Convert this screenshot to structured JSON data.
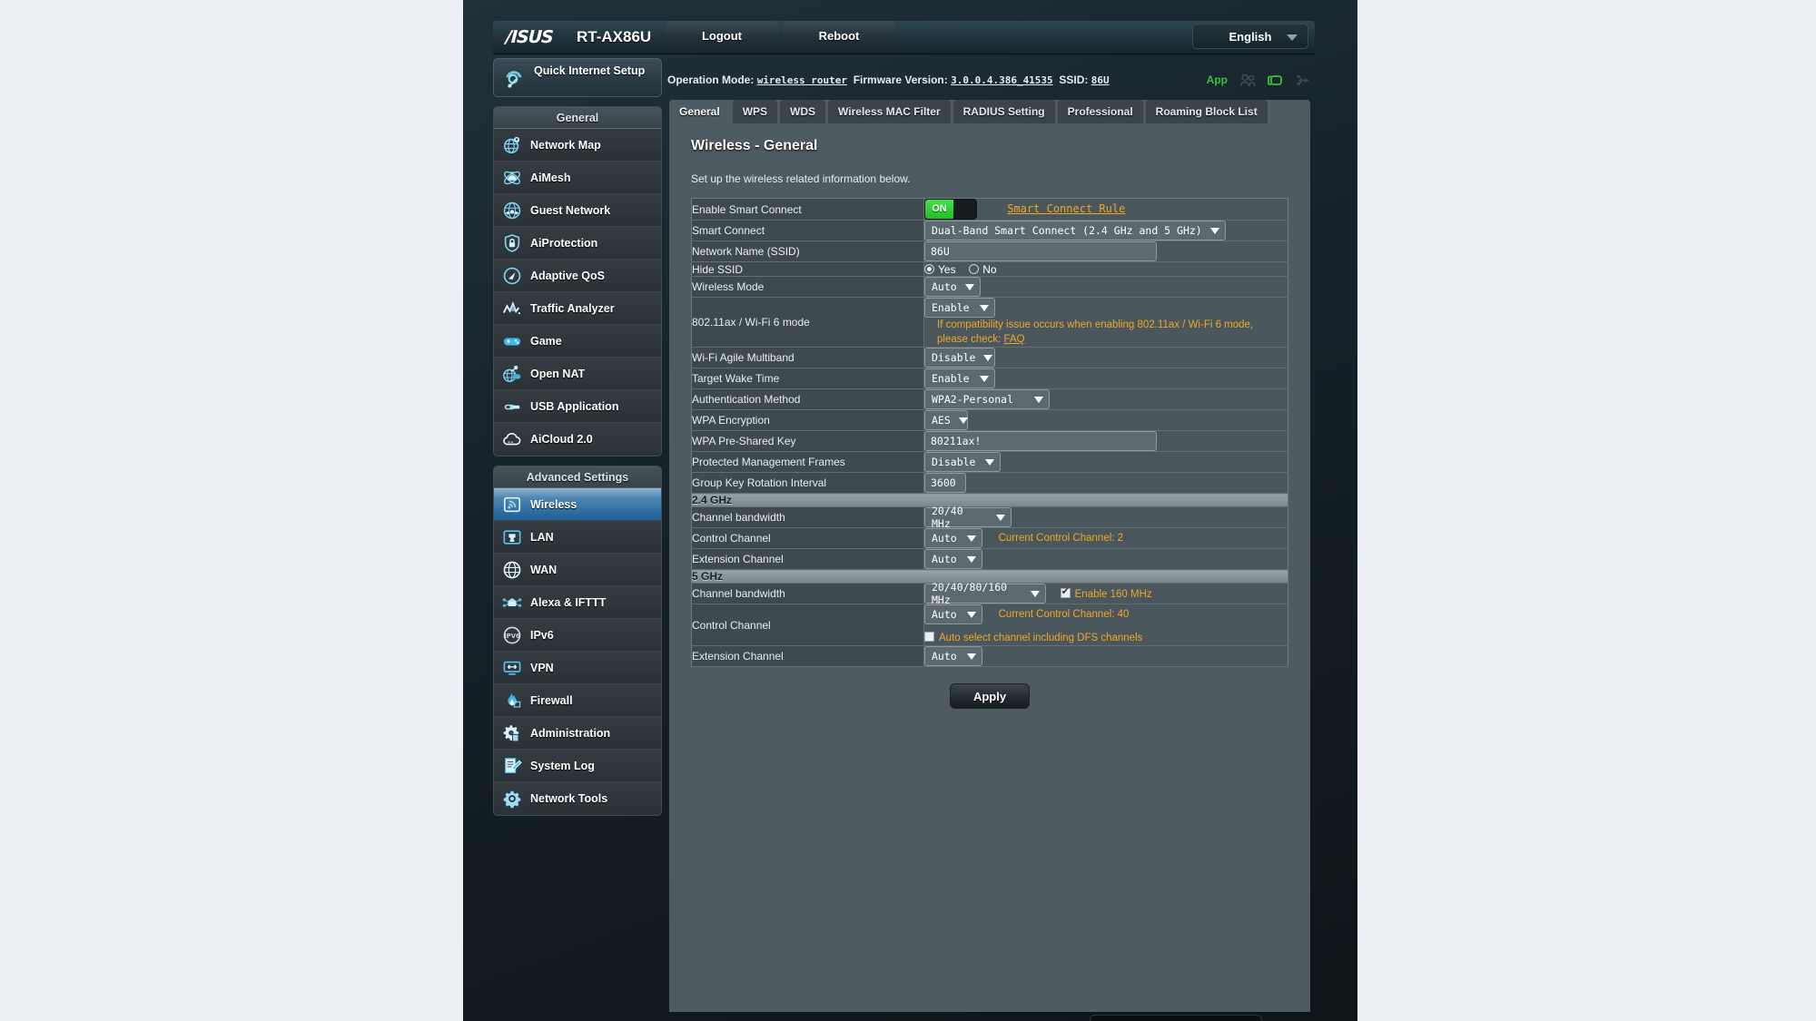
{
  "header": {
    "brand": "/ISUS",
    "model": "RT-AX86U",
    "logout_label": "Logout",
    "reboot_label": "Reboot",
    "language": "English"
  },
  "infobar": {
    "operation_mode_label": "Operation Mode:",
    "operation_mode_value": "wireless router",
    "firmware_label": "Firmware Version:",
    "firmware_value": "3.0.0.4.386_41535",
    "ssid_label": "SSID:",
    "ssid_value": "86U",
    "app_label": "App"
  },
  "sidebar": {
    "quick_setup": "Quick Internet Setup",
    "general_header": "General",
    "general_items": [
      {
        "label": "Network Map",
        "icon": "network-map-icon"
      },
      {
        "label": "AiMesh",
        "icon": "aimesh-icon"
      },
      {
        "label": "Guest Network",
        "icon": "guest-network-icon"
      },
      {
        "label": "AiProtection",
        "icon": "shield-lock-icon"
      },
      {
        "label": "Adaptive QoS",
        "icon": "gauge-icon"
      },
      {
        "label": "Traffic Analyzer",
        "icon": "traffic-chart-icon"
      },
      {
        "label": "Game",
        "icon": "gamepad-icon"
      },
      {
        "label": "Open NAT",
        "icon": "open-nat-icon"
      },
      {
        "label": "USB Application",
        "icon": "usb-icon"
      },
      {
        "label": "AiCloud 2.0",
        "icon": "cloud-icon"
      }
    ],
    "advanced_header": "Advanced Settings",
    "advanced_items": [
      {
        "label": "Wireless",
        "icon": "wireless-icon",
        "active": true
      },
      {
        "label": "LAN",
        "icon": "lan-port-icon"
      },
      {
        "label": "WAN",
        "icon": "globe-icon"
      },
      {
        "label": "Alexa & IFTTT",
        "icon": "alexa-ifttt-icon"
      },
      {
        "label": "IPv6",
        "icon": "ipv6-icon"
      },
      {
        "label": "VPN",
        "icon": "vpn-monitor-icon"
      },
      {
        "label": "Firewall",
        "icon": "flame-icon"
      },
      {
        "label": "Administration",
        "icon": "gear-doc-icon"
      },
      {
        "label": "System Log",
        "icon": "log-pencil-icon"
      },
      {
        "label": "Network Tools",
        "icon": "gear-tools-icon"
      }
    ]
  },
  "tabs": [
    {
      "label": "General",
      "active": true
    },
    {
      "label": "WPS",
      "active": false
    },
    {
      "label": "WDS",
      "active": false
    },
    {
      "label": "Wireless MAC Filter",
      "active": false
    },
    {
      "label": "RADIUS Setting",
      "active": false
    },
    {
      "label": "Professional",
      "active": false
    },
    {
      "label": "Roaming Block List",
      "active": false
    }
  ],
  "panel": {
    "title": "Wireless - General",
    "description": "Set up the wireless related information below.",
    "apply_label": "Apply"
  },
  "form": {
    "enable_smart_connect": {
      "label": "Enable Smart Connect",
      "toggle_state": "ON",
      "rule_link": "Smart Connect Rule"
    },
    "smart_connect": {
      "label": "Smart Connect",
      "value": "Dual-Band Smart Connect (2.4 GHz and 5 GHz)"
    },
    "ssid": {
      "label": "Network Name (SSID)",
      "value": "86U"
    },
    "hide_ssid": {
      "label": "Hide SSID",
      "yes": "Yes",
      "no": "No",
      "selected": "Yes"
    },
    "wireless_mode": {
      "label": "Wireless Mode",
      "value": "Auto"
    },
    "ax_mode": {
      "label": "802.11ax / Wi-Fi 6 mode",
      "value": "Enable",
      "note": "If compatibility issue occurs when enabling 802.11ax / Wi-Fi 6 mode, please check: ",
      "note_link": "FAQ"
    },
    "agile_multiband": {
      "label": "Wi-Fi Agile Multiband",
      "value": "Disable"
    },
    "target_wake_time": {
      "label": "Target Wake Time",
      "value": "Enable"
    },
    "auth_method": {
      "label": "Authentication Method",
      "value": "WPA2-Personal"
    },
    "wpa_encryption": {
      "label": "WPA Encryption",
      "value": "AES"
    },
    "wpa_psk": {
      "label": "WPA Pre-Shared Key",
      "value": "80211ax!"
    },
    "pmf": {
      "label": "Protected Management Frames",
      "value": "Disable"
    },
    "group_key": {
      "label": "Group Key Rotation Interval",
      "value": "3600"
    },
    "band24_header": "2.4 GHz",
    "band24_bandwidth": {
      "label": "Channel bandwidth",
      "value": "20/40 MHz"
    },
    "band24_control": {
      "label": "Control Channel",
      "value": "Auto",
      "current": "Current Control Channel: 2"
    },
    "band24_extension": {
      "label": "Extension Channel",
      "value": "Auto"
    },
    "band5_header": "5 GHz",
    "band5_bandwidth": {
      "label": "Channel bandwidth",
      "value": "20/40/80/160 MHz",
      "checkbox_label": "Enable 160 MHz",
      "checkbox_checked": true
    },
    "band5_control": {
      "label": "Control Channel",
      "value": "Auto",
      "current": "Current Control Channel: 40",
      "dfs_label": "Auto select channel including DFS channels",
      "dfs_checked": false
    },
    "band5_extension": {
      "label": "Extension Channel",
      "value": "Auto"
    }
  },
  "colors": {
    "accent_amber": "#f0a724",
    "accent_green": "#37c23a",
    "active_blue": "#1c5f96",
    "panel_bg": "#4e5b60"
  }
}
